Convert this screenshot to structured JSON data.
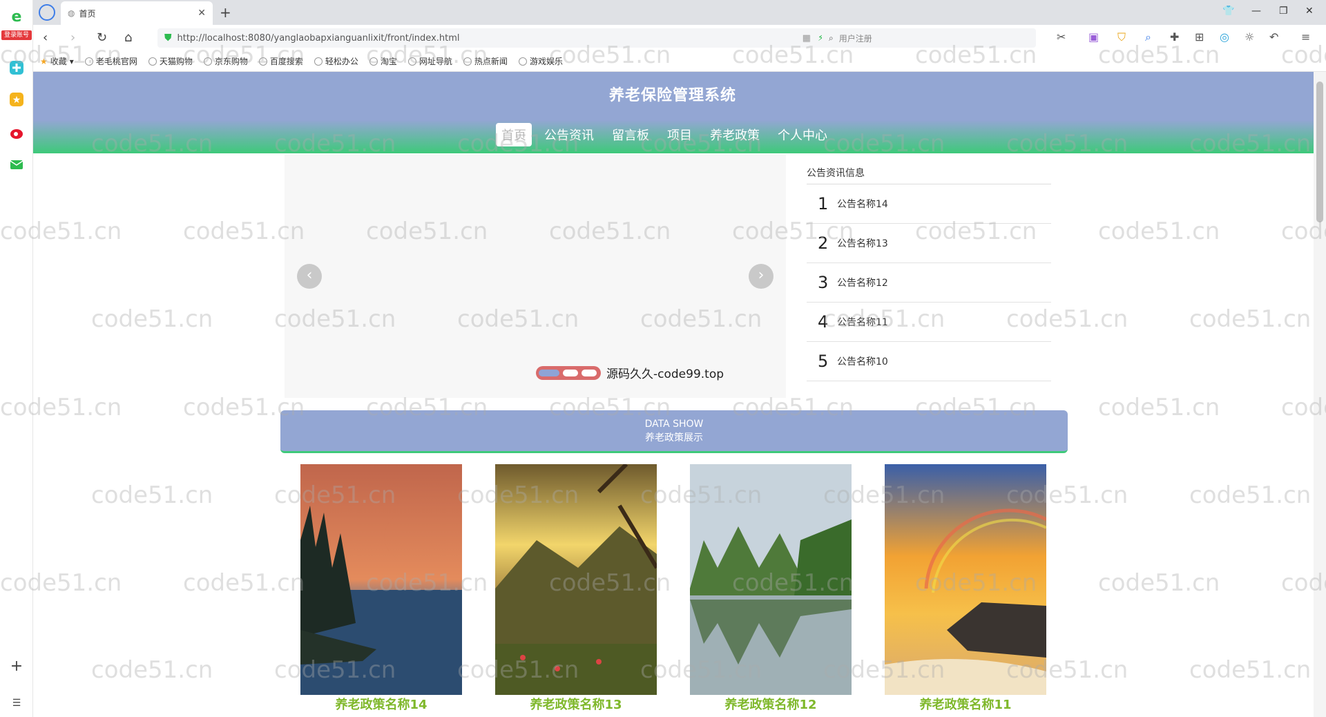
{
  "browser": {
    "tab_title": "首页",
    "url": "http://localhost:8080/yanglaobapxianguanlixit/front/index.html",
    "search_placeholder": "用户注册",
    "rail_badge": "登录账号",
    "bookmarks": [
      "收藏",
      "老毛桃官网",
      "天猫购物",
      "京东购物",
      "百度搜索",
      "轻松办公",
      "淘宝",
      "网址导航",
      "热点新闻",
      "游戏娱乐"
    ]
  },
  "site": {
    "title": "养老保险管理系统",
    "nav": [
      "首页",
      "公告资讯",
      "留言板",
      "项目",
      "养老政策",
      "个人中心"
    ],
    "active_nav": 0
  },
  "carousel": {
    "caption": "源码久久-code99.top",
    "slide_count": 3,
    "active_slide": 0
  },
  "news": {
    "title": "公告资讯信息",
    "items": [
      {
        "num": "1",
        "text": "公告名称14"
      },
      {
        "num": "2",
        "text": "公告名称13"
      },
      {
        "num": "3",
        "text": "公告名称12"
      },
      {
        "num": "4",
        "text": "公告名称11"
      },
      {
        "num": "5",
        "text": "公告名称10"
      }
    ]
  },
  "datashow": {
    "line1": "DATA SHOW",
    "line2": "养老政策展示"
  },
  "policies": [
    {
      "name": "养老政策名称14",
      "scene": "moon-lake"
    },
    {
      "name": "养老政策名称13",
      "scene": "sunset-mountains"
    },
    {
      "name": "养老政策名称12",
      "scene": "karst-reflection"
    },
    {
      "name": "养老政策名称11",
      "scene": "rainbow-beach"
    }
  ],
  "watermark": "code51.cn",
  "colors": {
    "header_blue": "#93a6d3",
    "header_green": "#3ec97a",
    "policy_name": "#7fb82b"
  }
}
